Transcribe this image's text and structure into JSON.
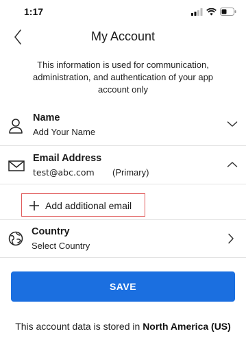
{
  "status": {
    "time": "1:17"
  },
  "header": {
    "title": "My Account"
  },
  "description": "This information is used for communication, administration, and authentication of your app account only",
  "name_row": {
    "label": "Name",
    "value": "Add Your Name"
  },
  "email_row": {
    "label": "Email Address",
    "value": "test@abc.com",
    "tag": "(Primary)"
  },
  "add_email": {
    "label": "Add additional email"
  },
  "country_row": {
    "label": "Country",
    "value": "Select Country"
  },
  "save": {
    "label": "SAVE"
  },
  "footer": {
    "prefix": "This account data is stored in",
    "region": "North America (US)"
  },
  "colors": {
    "primary": "#1b6fe0",
    "highlight_border": "#e05a5a"
  }
}
